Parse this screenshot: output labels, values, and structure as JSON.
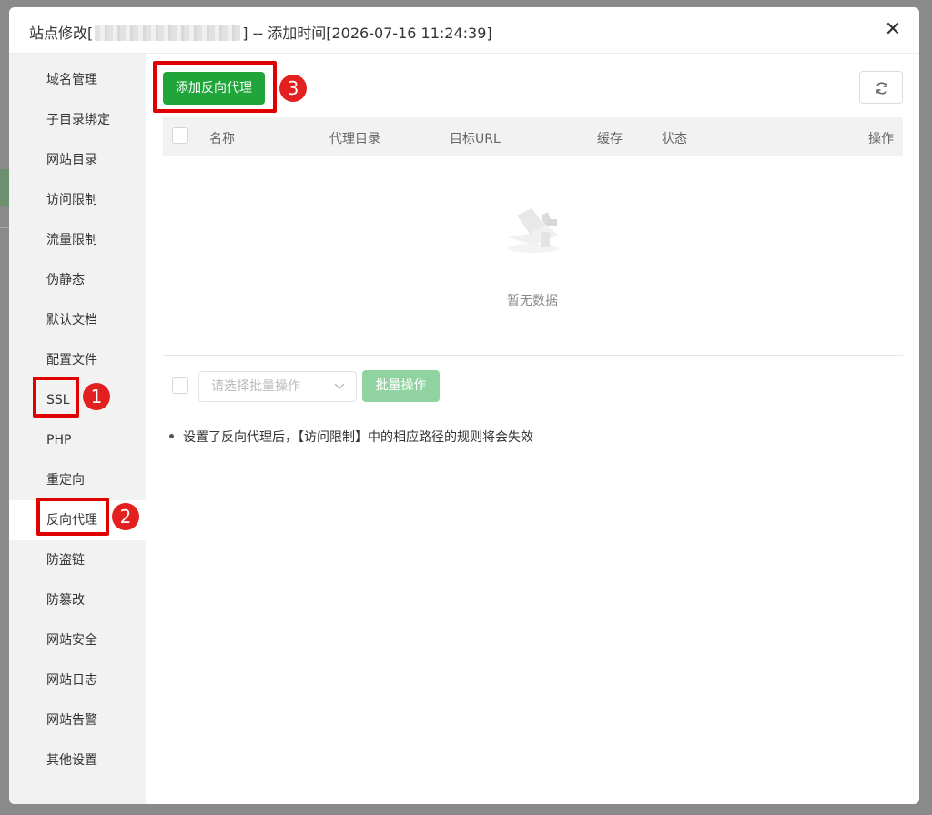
{
  "window": {
    "title_prefix": "站点修改[",
    "title_suffix": "] -- 添加时间[2026-07-16 11:24:39]",
    "close_label": "✕"
  },
  "sidebar": {
    "items": [
      {
        "label": "域名管理"
      },
      {
        "label": "子目录绑定"
      },
      {
        "label": "网站目录"
      },
      {
        "label": "访问限制"
      },
      {
        "label": "流量限制"
      },
      {
        "label": "伪静态"
      },
      {
        "label": "默认文档"
      },
      {
        "label": "配置文件"
      },
      {
        "label": "SSL"
      },
      {
        "label": "PHP"
      },
      {
        "label": "重定向"
      },
      {
        "label": "反向代理",
        "active": true
      },
      {
        "label": "防盗链"
      },
      {
        "label": "防篡改"
      },
      {
        "label": "网站安全"
      },
      {
        "label": "网站日志"
      },
      {
        "label": "网站告警"
      },
      {
        "label": "其他设置"
      }
    ]
  },
  "annotations": {
    "badge_1": "1",
    "badge_2": "2",
    "badge_3": "3",
    "color": "#e32020"
  },
  "toolbar": {
    "add_label": "添加反向代理",
    "refresh_icon": "refresh-icon"
  },
  "table": {
    "columns": [
      "名称",
      "代理目录",
      "目标URL",
      "缓存",
      "状态",
      "操作"
    ],
    "rows": [],
    "empty_text": "暂无数据"
  },
  "batch": {
    "select_placeholder": "请选择批量操作",
    "button_label": "批量操作"
  },
  "note": "设置了反向代理后，【访问限制】中的相应路径的规则将会失效",
  "colors": {
    "primary": "#20a53a",
    "primary_disabled": "#90d3a0"
  }
}
